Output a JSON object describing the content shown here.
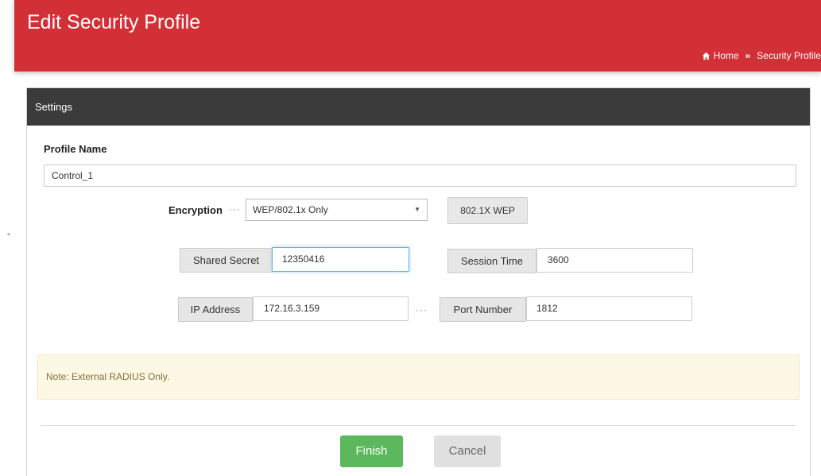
{
  "header": {
    "title": "Edit Security Profile",
    "breadcrumb": {
      "home": "Home",
      "current": "Security Profile",
      "separator": "»"
    }
  },
  "panel": {
    "title": "Settings"
  },
  "form": {
    "profile_name_label": "Profile Name",
    "profile_name_value": "Control_1",
    "encryption_label": "Encryption",
    "encryption_selected": "WEP/802.1x Only",
    "mode_button": "802.1X WEP",
    "shared_secret_label": "Shared Secret",
    "shared_secret_value": "12350416",
    "session_time_label": "Session Time",
    "session_time_value": "3600",
    "ip_address_label": "IP Address",
    "ip_address_value": "172.16.3.159",
    "port_number_label": "Port Number",
    "port_number_value": "1812"
  },
  "note": "Note: External RADIUS Only.",
  "actions": {
    "finish": "Finish",
    "cancel": "Cancel"
  },
  "colors": {
    "header": "#d32f36",
    "panel_head": "#3b3b3b",
    "finish": "#5cb85c",
    "note_bg": "#fcf8e3"
  },
  "icons": {
    "home": "home-icon",
    "select_caret": "caret-down-icon"
  }
}
